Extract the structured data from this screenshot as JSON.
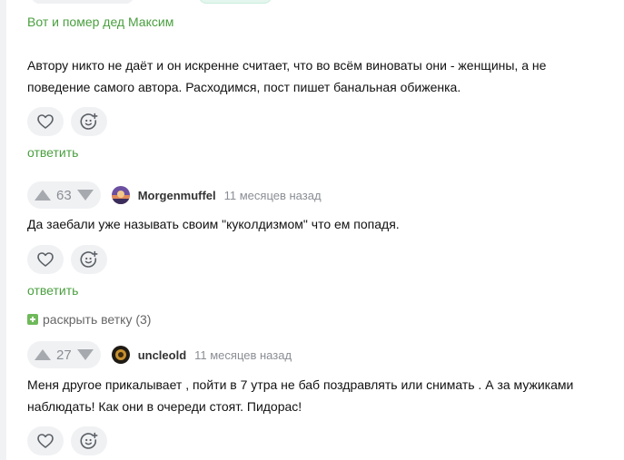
{
  "parent_comment": {
    "quote_link": "Вот и помер дед Максим",
    "text": "Автору никто не даёт и он искренне считает, что во всём виноваты они - женщины, а не поведение самого автора. Расходимся, пост пишет банальная обиженка.",
    "reply_label": "ответить"
  },
  "comments": [
    {
      "rating": "63",
      "author": "Morgenmuffel",
      "time": "11 месяцев назад",
      "text": "Да заебали уже называть своим \"кукoлдизмом\" что ем попадя.",
      "reply_label": "ответить"
    },
    {
      "rating": "27",
      "author": "uncleold",
      "time": "11 месяцев назад",
      "text": "Меня другое прикалывает , пойти в 7 утра не баб поздравлять или снимать . А за мужиками наблюдать! Как они в очереди стоят. Пидорас!"
    }
  ],
  "expand_thread_label": "раскрыть ветку (3)",
  "colors": {
    "link_green": "#4a9f3f",
    "pill_bg": "#f0f1f3",
    "muted_text": "#8a8e94"
  },
  "icons": {
    "like": "heart-icon",
    "react": "smiley-plus-icon",
    "upvote": "arrow-up-icon",
    "downvote": "arrow-down-icon",
    "expand": "plus-square-icon"
  }
}
